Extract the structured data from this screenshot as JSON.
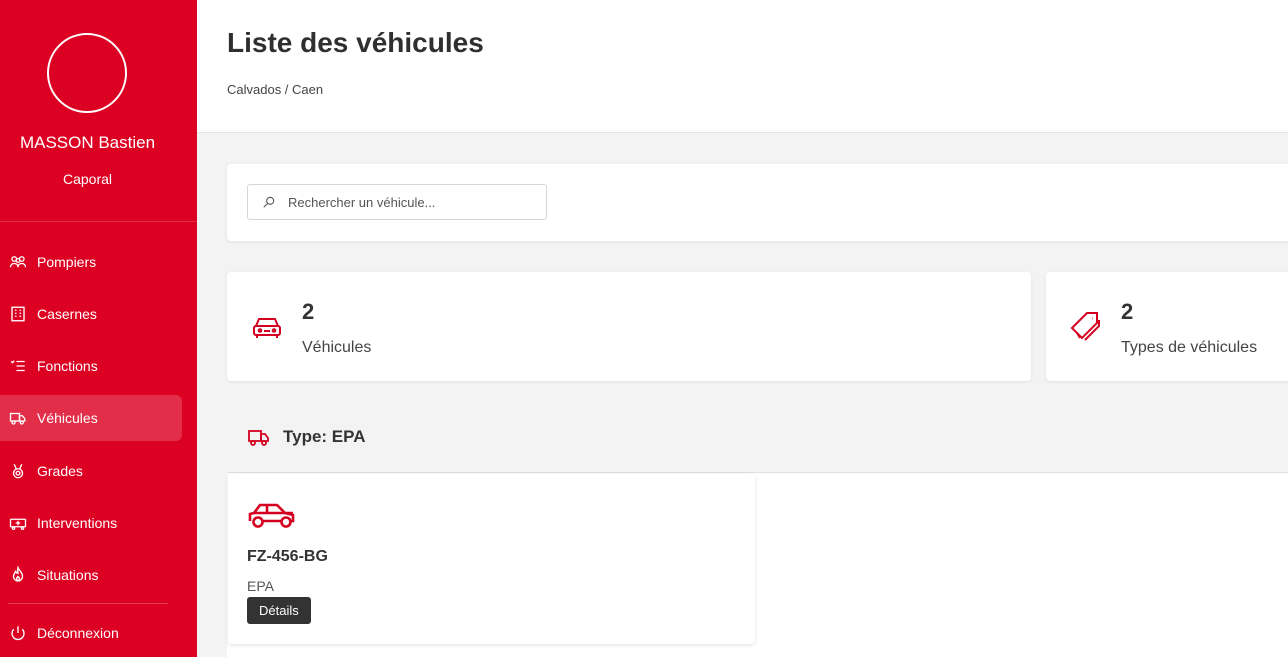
{
  "user": {
    "name": "MASSON Bastien",
    "rank": "Caporal"
  },
  "nav": {
    "items": [
      {
        "label": "Pompiers",
        "icon": "firefighters-icon"
      },
      {
        "label": "Casernes",
        "icon": "building-icon"
      },
      {
        "label": "Fonctions",
        "icon": "checklist-icon"
      },
      {
        "label": "Véhicules",
        "icon": "truck-icon",
        "active": true
      },
      {
        "label": "Grades",
        "icon": "medal-icon"
      },
      {
        "label": "Interventions",
        "icon": "ambulance-icon"
      },
      {
        "label": "Situations",
        "icon": "fire-icon"
      }
    ],
    "logout": {
      "label": "Déconnexion",
      "icon": "power-icon"
    }
  },
  "header": {
    "title": "Liste des véhicules",
    "breadcrumb": "Calvados / Caen"
  },
  "search": {
    "placeholder": "Rechercher un véhicule..."
  },
  "stats": [
    {
      "value": "2",
      "label": "Véhicules",
      "icon": "car-front-icon"
    },
    {
      "value": "2",
      "label": "Types de véhicules",
      "icon": "tag-icon"
    }
  ],
  "group": {
    "title": "Type: EPA",
    "vehicles": [
      {
        "plate": "FZ-456-BG",
        "type": "EPA",
        "button": "Détails"
      }
    ]
  },
  "colors": {
    "brand": "#dc0022",
    "icon_red": "#d40020",
    "button_dark": "#333333"
  }
}
